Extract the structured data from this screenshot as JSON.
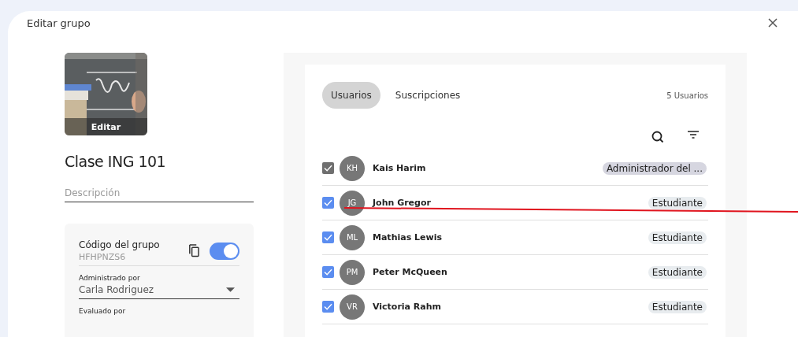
{
  "dialog": {
    "title": "Editar grupo"
  },
  "group": {
    "image_label": "Editar",
    "name": "Clase ING 101",
    "description": {
      "placeholder": "Descripción"
    },
    "code": {
      "label": "Código del grupo",
      "value": "HFHPNZS6",
      "on": true
    },
    "administered_by": {
      "label": "Administrado por",
      "value": "Carla Rodriguez"
    },
    "evaluated_by": {
      "label": "Evaluado por"
    }
  },
  "tabs": [
    {
      "label": "Usuarios",
      "selected": true
    },
    {
      "label": "Suscripciones",
      "selected": false
    }
  ],
  "user_count": "5 Usuarios",
  "users": [
    {
      "initials": "KH",
      "name": "Kais Harim",
      "role": "Administrador del ...",
      "color": "#d6d6e0",
      "checked": true,
      "disabled": true
    },
    {
      "initials": "JG",
      "name": "John Gregor",
      "role": "Estudiante",
      "color": "#e8ecef",
      "checked": true,
      "disabled": false
    },
    {
      "initials": "ML",
      "name": "Mathias Lewis",
      "role": "Estudiante",
      "color": "#e8ecef",
      "checked": true,
      "disabled": false
    },
    {
      "initials": "PM",
      "name": "Peter McQueen",
      "role": "Estudiante",
      "color": "#e8ecef",
      "checked": true,
      "disabled": false
    },
    {
      "initials": "VR",
      "name": "Victoria Rahm",
      "role": "Estudiante",
      "color": "#e8ecef",
      "checked": true,
      "disabled": false
    }
  ]
}
